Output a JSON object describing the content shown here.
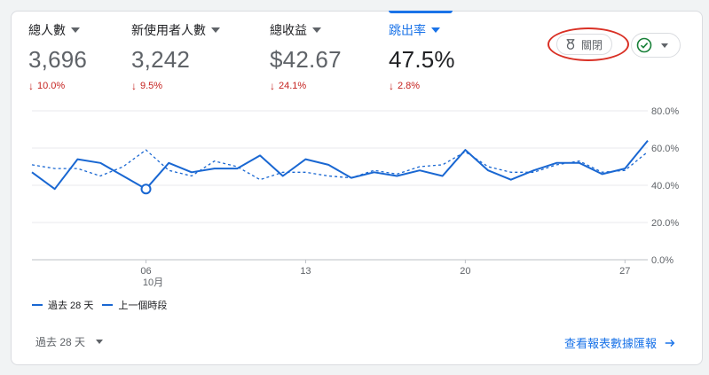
{
  "metrics": [
    {
      "label": "總人數",
      "value": "3,696",
      "change": "10.0%"
    },
    {
      "label": "新使用者人數",
      "value": "3,242",
      "change": "9.5%"
    },
    {
      "label": "總收益",
      "value": "$42.67",
      "change": "24.1%"
    },
    {
      "label": "跳出率",
      "value": "47.5%",
      "change": "2.8%"
    }
  ],
  "controls": {
    "toggle_label": "關閉"
  },
  "legend": {
    "current": "過去 28 天",
    "previous": "上一個時段"
  },
  "footer": {
    "date_range": "過去 28 天",
    "report_link": "查看報表數據匯報"
  },
  "colors": {
    "accent": "#1a73e8",
    "series": "#1967d2",
    "negative": "#c5221f",
    "annotation": "#d93025"
  },
  "icons": {
    "toggle": "insights-icon",
    "check": "check-circle-icon",
    "link": "arrow-right-icon"
  },
  "chart_data": {
    "type": "line",
    "x": [
      1,
      2,
      3,
      4,
      5,
      6,
      7,
      8,
      9,
      10,
      11,
      12,
      13,
      14,
      15,
      16,
      17,
      18,
      19,
      20,
      21,
      22,
      23,
      24,
      25,
      26,
      27,
      28
    ],
    "x_tick_labels": [
      {
        "x": 6,
        "label": "06",
        "sublabel": "10月"
      },
      {
        "x": 13,
        "label": "13"
      },
      {
        "x": 20,
        "label": "20"
      },
      {
        "x": 27,
        "label": "27"
      }
    ],
    "ylim": [
      0,
      80
    ],
    "y_tick_labels": [
      "80.0%",
      "60.0%",
      "40.0%",
      "20.0%",
      "0.0%"
    ],
    "y_ticks": [
      80,
      60,
      40,
      20,
      0
    ],
    "grid": true,
    "highlight_point": {
      "series": 0,
      "x": 6
    },
    "series": [
      {
        "name": "過去 28 天",
        "style": "solid",
        "values": [
          47,
          38,
          54,
          52,
          45,
          38,
          52,
          47,
          49,
          49,
          56,
          45,
          54,
          51,
          44,
          47,
          45,
          48,
          45,
          59,
          48,
          43,
          48,
          52,
          52,
          46,
          49,
          64
        ]
      },
      {
        "name": "上一個時段",
        "style": "dashed",
        "values": [
          51,
          49,
          49,
          45,
          50,
          59,
          48,
          45,
          53,
          50,
          43,
          47,
          47,
          45,
          44,
          48,
          46,
          50,
          51,
          58,
          50,
          47,
          47,
          51,
          53,
          47,
          48,
          58
        ]
      }
    ]
  }
}
